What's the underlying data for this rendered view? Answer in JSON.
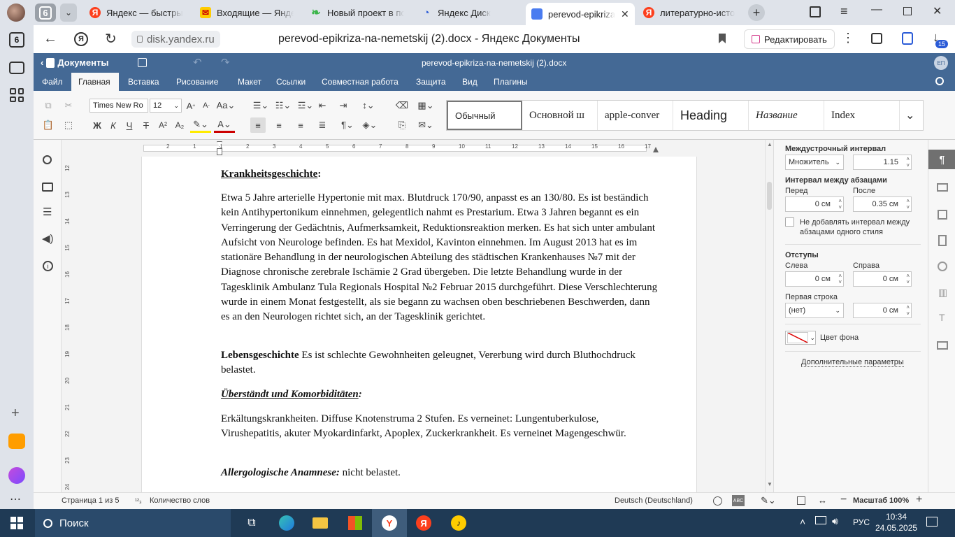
{
  "browser": {
    "tab_count": "6",
    "tabs": [
      {
        "label": "Яндекс — быстрый",
        "icon": "yandex-icon"
      },
      {
        "label": "Входящие — Яндекс",
        "icon": "mail-icon"
      },
      {
        "label": "Новый проект в пс",
        "icon": "leaf-icon"
      },
      {
        "label": "Яндекс Диск",
        "icon": "disk-icon"
      },
      {
        "label": "perevod-epikriza",
        "icon": "docs-icon",
        "active": true
      },
      {
        "label": "литературно-исто",
        "icon": "yandex-icon"
      }
    ],
    "url_domain": "disk.yandex.ru",
    "page_title": "perevod-epikriza-na-nemetskij (2).docx - Яндекс Документы",
    "edit_button": "Редактировать",
    "downloads_badge": "15",
    "sidebar_badge": "6"
  },
  "app": {
    "back_label": "Документы",
    "doc_title": "perevod-epikriza-na-nemetskij (2).docx",
    "user_initials": "ЕП",
    "menu_tabs": [
      "Файл",
      "Главная",
      "Вставка",
      "Рисование",
      "Макет",
      "Ссылки",
      "Совместная работа",
      "Защита",
      "Вид",
      "Плагины"
    ],
    "active_tab": "Главная"
  },
  "ribbon": {
    "font_name": "Times New Ro",
    "font_size": "12",
    "styles": [
      "Обычный",
      "Основной ш",
      "apple-conver",
      "Heading",
      "Название",
      "Index"
    ],
    "bold": "Ж",
    "italic": "К",
    "underline": "Ч",
    "strike": "Т"
  },
  "document": {
    "h1": "Krankheitsgeschichte",
    "h1_colon": ":",
    "para1": "Etwa 5 Jahre arterielle Hypertonie mit max. Blutdruck 170/90, anpasst es an 130/80. Es ist beständich kein Antihypertonikum einnehmen, gelegentlich nahmt es Prestarium. Etwa 3 Jahren begannt es ein Verringerung der Gedächtnis, Aufmerksamkeit, Reduktionsreaktion merken. Es hat sich unter ambulant Aufsicht von Neurologe befinden. Es hat Mexidol, Kavinton einnehmen. Im August 2013 hat es im stationäre Behandlung in der neurologischen Abteilung des städtischen Krankenhauses №7 mit der Diagnose chronische zerebrale Ischämie 2 Grad übergeben. Die letzte Behandlung wurde in der Tagesklinik Ambulanz Tula Regionals Hospital №2 Februar 2015 durchgeführt. Diese Verschlechterung wurde in einem Monat festgestellt, als sie begann zu wachsen oben beschriebenen Beschwerden, dann es an den Neurologen richtet sich, an der Tagesklinik gerichtet.",
    "h2": "Lebensgeschichte",
    "para2": " Es ist schlechte Gewohnheiten geleugnet, Vererbung wird durch Bluthochdruck belastet.",
    "h3": "Überständt und Komorbiditäten",
    "h3_colon": ":",
    "para3": "Erkältungskrankheiten. Diffuse Knotenstruma 2 Stufen. Es verneinet: Lungentuberkulose, Virushepatitis, akuter Myokardinfarkt, Apoplex, Zuckerkrankheit. Es verneinet Magengeschwür.",
    "h4": "Allergologische Anamnese:",
    "para4": " nicht belastet."
  },
  "ruler": {
    "h_ticks": [
      "2",
      "1",
      "1",
      "2",
      "3",
      "4",
      "5",
      "6",
      "7",
      "8",
      "9",
      "10",
      "11",
      "12",
      "13",
      "14",
      "15",
      "16",
      "17"
    ],
    "v_ticks": [
      "12",
      "13",
      "14",
      "15",
      "16",
      "17",
      "18",
      "19",
      "20",
      "21",
      "22",
      "23",
      "24"
    ]
  },
  "panel": {
    "line_spacing_label": "Междустрочный интервал",
    "line_spacing_mode": "Множитель",
    "line_spacing_value": "1.15",
    "para_spacing_label": "Интервал между абзацами",
    "before_label": "Перед",
    "before_value": "0 см",
    "after_label": "После",
    "after_value": "0.35 см",
    "no_interval_label": "Не добавлять интервал между абзацами одного стиля",
    "indents_label": "Отступы",
    "left_label": "Слева",
    "left_value": "0 см",
    "right_label": "Справа",
    "right_value": "0 см",
    "first_line_label": "Первая строка",
    "first_line_mode": "(нет)",
    "first_line_value": "0 см",
    "bg_color_label": "Цвет фона",
    "more_params": "Дополнительные параметры"
  },
  "status": {
    "page": "Страница 1 из 5",
    "word_count": "Количество слов",
    "language": "Deutsch (Deutschland)",
    "zoom": "Масштаб 100%"
  },
  "taskbar": {
    "search": "Поиск",
    "lang": "РУС",
    "time": "10:34",
    "date": "24.05.2025"
  },
  "colors": {
    "app_blue": "#446995",
    "tab_bg": "#dfe3ea",
    "taskbar": "#1f3a55"
  }
}
